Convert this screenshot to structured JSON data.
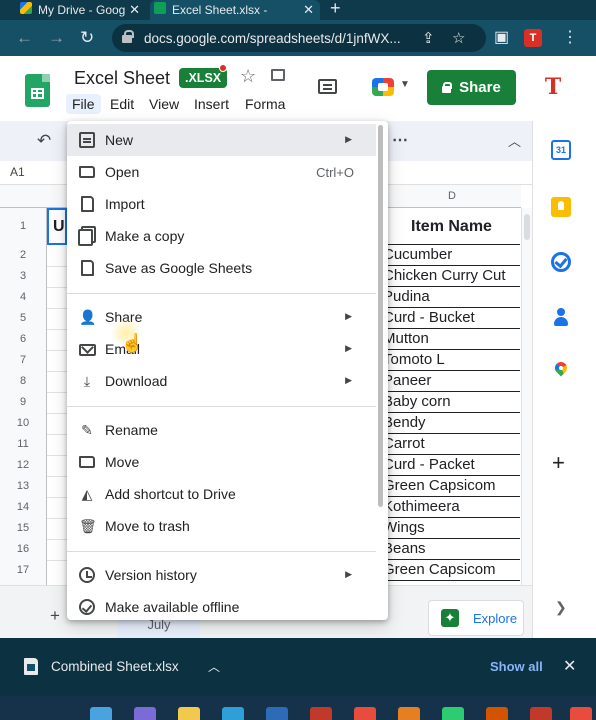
{
  "browser": {
    "tabs": [
      {
        "title": "My Drive - Goog"
      },
      {
        "title": "Excel Sheet.xlsx -"
      }
    ],
    "url": "docs.google.com/spreadsheets/d/1jnfWX..."
  },
  "sheets": {
    "doc_title": "Excel Sheet",
    "format_badge": ".XLSX",
    "menus": [
      "File",
      "Edit",
      "View",
      "Insert",
      "Forma"
    ],
    "share_label": "Share",
    "avatar_label": "T",
    "name_box": "A1",
    "columns": {
      "d": "D"
    },
    "u1_text": "U",
    "item_header": "Item Name",
    "items": [
      "Cucumber",
      "Chicken Curry Cut",
      "Pudina",
      "Curd - Bucket",
      "Mutton",
      "Tomoto L",
      "Paneer",
      "Baby corn",
      "Bendy",
      "Carrot",
      "Curd - Packet",
      "Green Capsicom",
      "Kothimeera",
      "Wings",
      "Beans",
      "Green Capsicom"
    ],
    "rows": [
      "1",
      "2",
      "3",
      "4",
      "5",
      "6",
      "7",
      "8",
      "9",
      "10",
      "11",
      "12",
      "13",
      "14",
      "15",
      "16",
      "17"
    ],
    "sheet_tab": "July",
    "explore_label": "Explore",
    "calendar_day": "31"
  },
  "file_menu": {
    "items": [
      {
        "label": "New",
        "icon": "sheet-plus-icon",
        "submenu": true
      },
      {
        "label": "Open",
        "icon": "folder-icon",
        "shortcut": "Ctrl+O"
      },
      {
        "label": "Import",
        "icon": "file-icon"
      },
      {
        "label": "Make a copy",
        "icon": "copy-icon"
      },
      {
        "label": "Save as Google Sheets",
        "icon": "file-icon"
      },
      {
        "label": "Share",
        "icon": "person-add-icon",
        "submenu": true
      },
      {
        "label": "Email",
        "icon": "mail-icon",
        "submenu": true
      },
      {
        "label": "Download",
        "icon": "download-icon",
        "submenu": true
      },
      {
        "label": "Rename",
        "icon": "pencil-icon"
      },
      {
        "label": "Move",
        "icon": "folder-move-icon"
      },
      {
        "label": "Add shortcut to Drive",
        "icon": "drive-shortcut-icon"
      },
      {
        "label": "Move to trash",
        "icon": "trash-icon"
      },
      {
        "label": "Version history",
        "icon": "history-icon",
        "submenu": true
      },
      {
        "label": "Make available offline",
        "icon": "offline-icon"
      }
    ]
  },
  "download_bar": {
    "file_name": "Combined Sheet.xlsx",
    "show_all": "Show all"
  },
  "colors": {
    "sheets_green": "#188038",
    "chrome_teal": "#155066",
    "menu_highlight": "#e8eaed"
  }
}
